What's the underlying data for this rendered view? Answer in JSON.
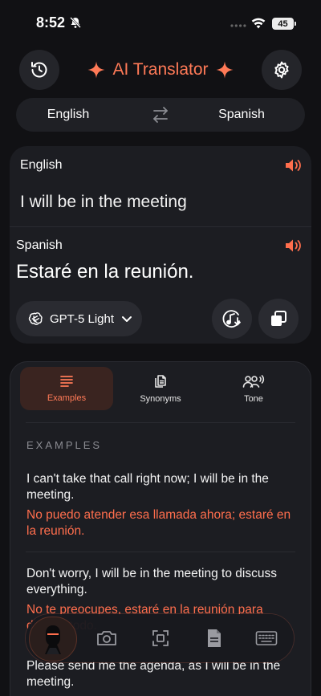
{
  "status_bar": {
    "time": "8:52",
    "battery": "45"
  },
  "header": {
    "title": "AI Translator"
  },
  "languages": {
    "source": "English",
    "target": "Spanish"
  },
  "translation": {
    "source_label": "English",
    "source_text": "I will be in the meeting",
    "target_label": "Spanish",
    "target_text": "Estaré en la reunión.",
    "model": "GPT-5 Light"
  },
  "tabs": [
    {
      "label": "Examples",
      "icon": "list-icon",
      "active": true
    },
    {
      "label": "Synonyms",
      "icon": "documents-icon",
      "active": false
    },
    {
      "label": "Tone",
      "icon": "people-voice-icon",
      "active": false
    }
  ],
  "examples_section": {
    "heading": "EXAMPLES",
    "items": [
      {
        "en": "I can't take that call right now; I will be in the meeting.",
        "es": "No puedo atender esa llamada ahora; estaré en la reunión."
      },
      {
        "en": "Don't worry, I will be in the meeting to discuss everything.",
        "es": "No te preocupes, estaré en la reunión para discutir todo."
      },
      {
        "en": "Please send me the agenda, as I will be in the meeting.",
        "es": ""
      }
    ]
  },
  "colors": {
    "accent": "#ff7a57",
    "background": "#111114",
    "card": "#1c1d22"
  },
  "input_bar_icons": [
    "avatar-icon",
    "camera-icon",
    "scan-icon",
    "document-icon",
    "keyboard-icon"
  ]
}
